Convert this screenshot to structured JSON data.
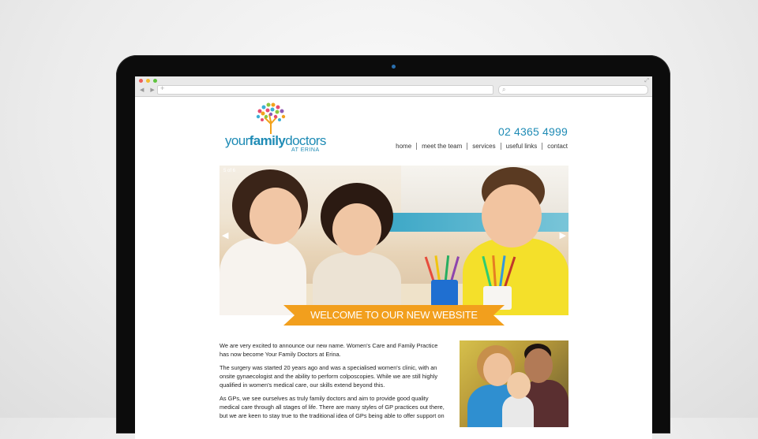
{
  "browser": {
    "nav_arrows": "◀ ▶",
    "new_tab_icon": "+",
    "search_icon": "⌕",
    "expand_icon": "⤢"
  },
  "site": {
    "logo_text_regular_1": "your",
    "logo_text_bold": "family",
    "logo_text_regular_2": "doctors",
    "logo_subtitle": "AT ERINA",
    "phone": "02 4365 4999",
    "nav": [
      "home",
      "meet the team",
      "services",
      "useful links",
      "contact"
    ],
    "brand_color": "#1e8bb5",
    "accent_color": "#f29f1d"
  },
  "hero": {
    "slide_counter": "5 of 6",
    "prev_arrow": "◀",
    "next_arrow": "▶",
    "banner_text": "WELCOME TO OUR NEW WEBSITE"
  },
  "content": {
    "paragraphs": [
      "We are very excited to announce our new name. Women's Care and Family Practice has now become Your Family Doctors at Erina.",
      "The surgery was started 20 years ago and was a specialised women's clinic, with an onsite gynaecologist and the ability to perform colposcopies. While we are still highly qualified in women's medical care, our skills extend beyond this.",
      "As GPs, we see ourselves as truly family doctors and aim to provide good quality medical care through all stages of life. There are many styles of GP practices out there, but we are keen to stay true to the traditional idea of GPs being able to offer support on"
    ]
  }
}
